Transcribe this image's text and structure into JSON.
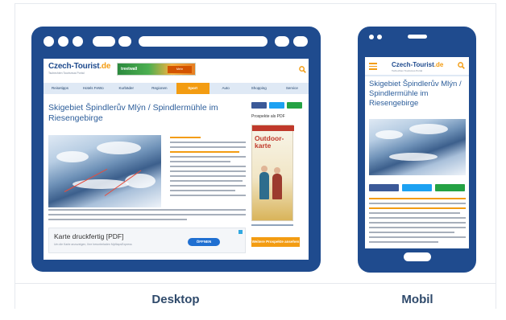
{
  "site": {
    "logo_main": "Czech-Tourist",
    "logo_tld": ".de",
    "tagline": "Tschechien Tourismus Portal",
    "banner_text": "treetwall",
    "banner_button": "Mehr Informationen",
    "nav": [
      {
        "label": "Reisetipps",
        "active": false
      },
      {
        "label": "Hotels FeWo",
        "active": false
      },
      {
        "label": "Kurbäder",
        "active": false
      },
      {
        "label": "Regionen",
        "active": false
      },
      {
        "label": "Sport",
        "active": true
      },
      {
        "label": "Auto",
        "active": false
      },
      {
        "label": "Shopping",
        "active": false
      },
      {
        "label": "Service",
        "active": false
      }
    ]
  },
  "article": {
    "title": "Skigebiet Špindlerův Mlýn / Spindlermühle im Riesengebirge"
  },
  "sidebar": {
    "pdf_heading": "Prospekte als PDF",
    "magazine_title": "Outdoor-karte",
    "cta": "Weitere Prospekte ansehen"
  },
  "ad": {
    "title": "Karte druckfertig [PDF]",
    "subtitle": "Um die Karte anzuzeigen, Ihre herunterladen MyMapsExpress",
    "button": "ÖFFNEN"
  },
  "captions": {
    "desktop": "Desktop",
    "mobile": "Mobil"
  },
  "colors": {
    "frame": "#1f4b8e",
    "accent": "#f39c12",
    "facebook": "#3b5998",
    "twitter": "#1da1f2",
    "whatsapp": "#25a244"
  },
  "icons": {
    "search": "search-icon",
    "menu": "hamburger-menu-icon"
  }
}
